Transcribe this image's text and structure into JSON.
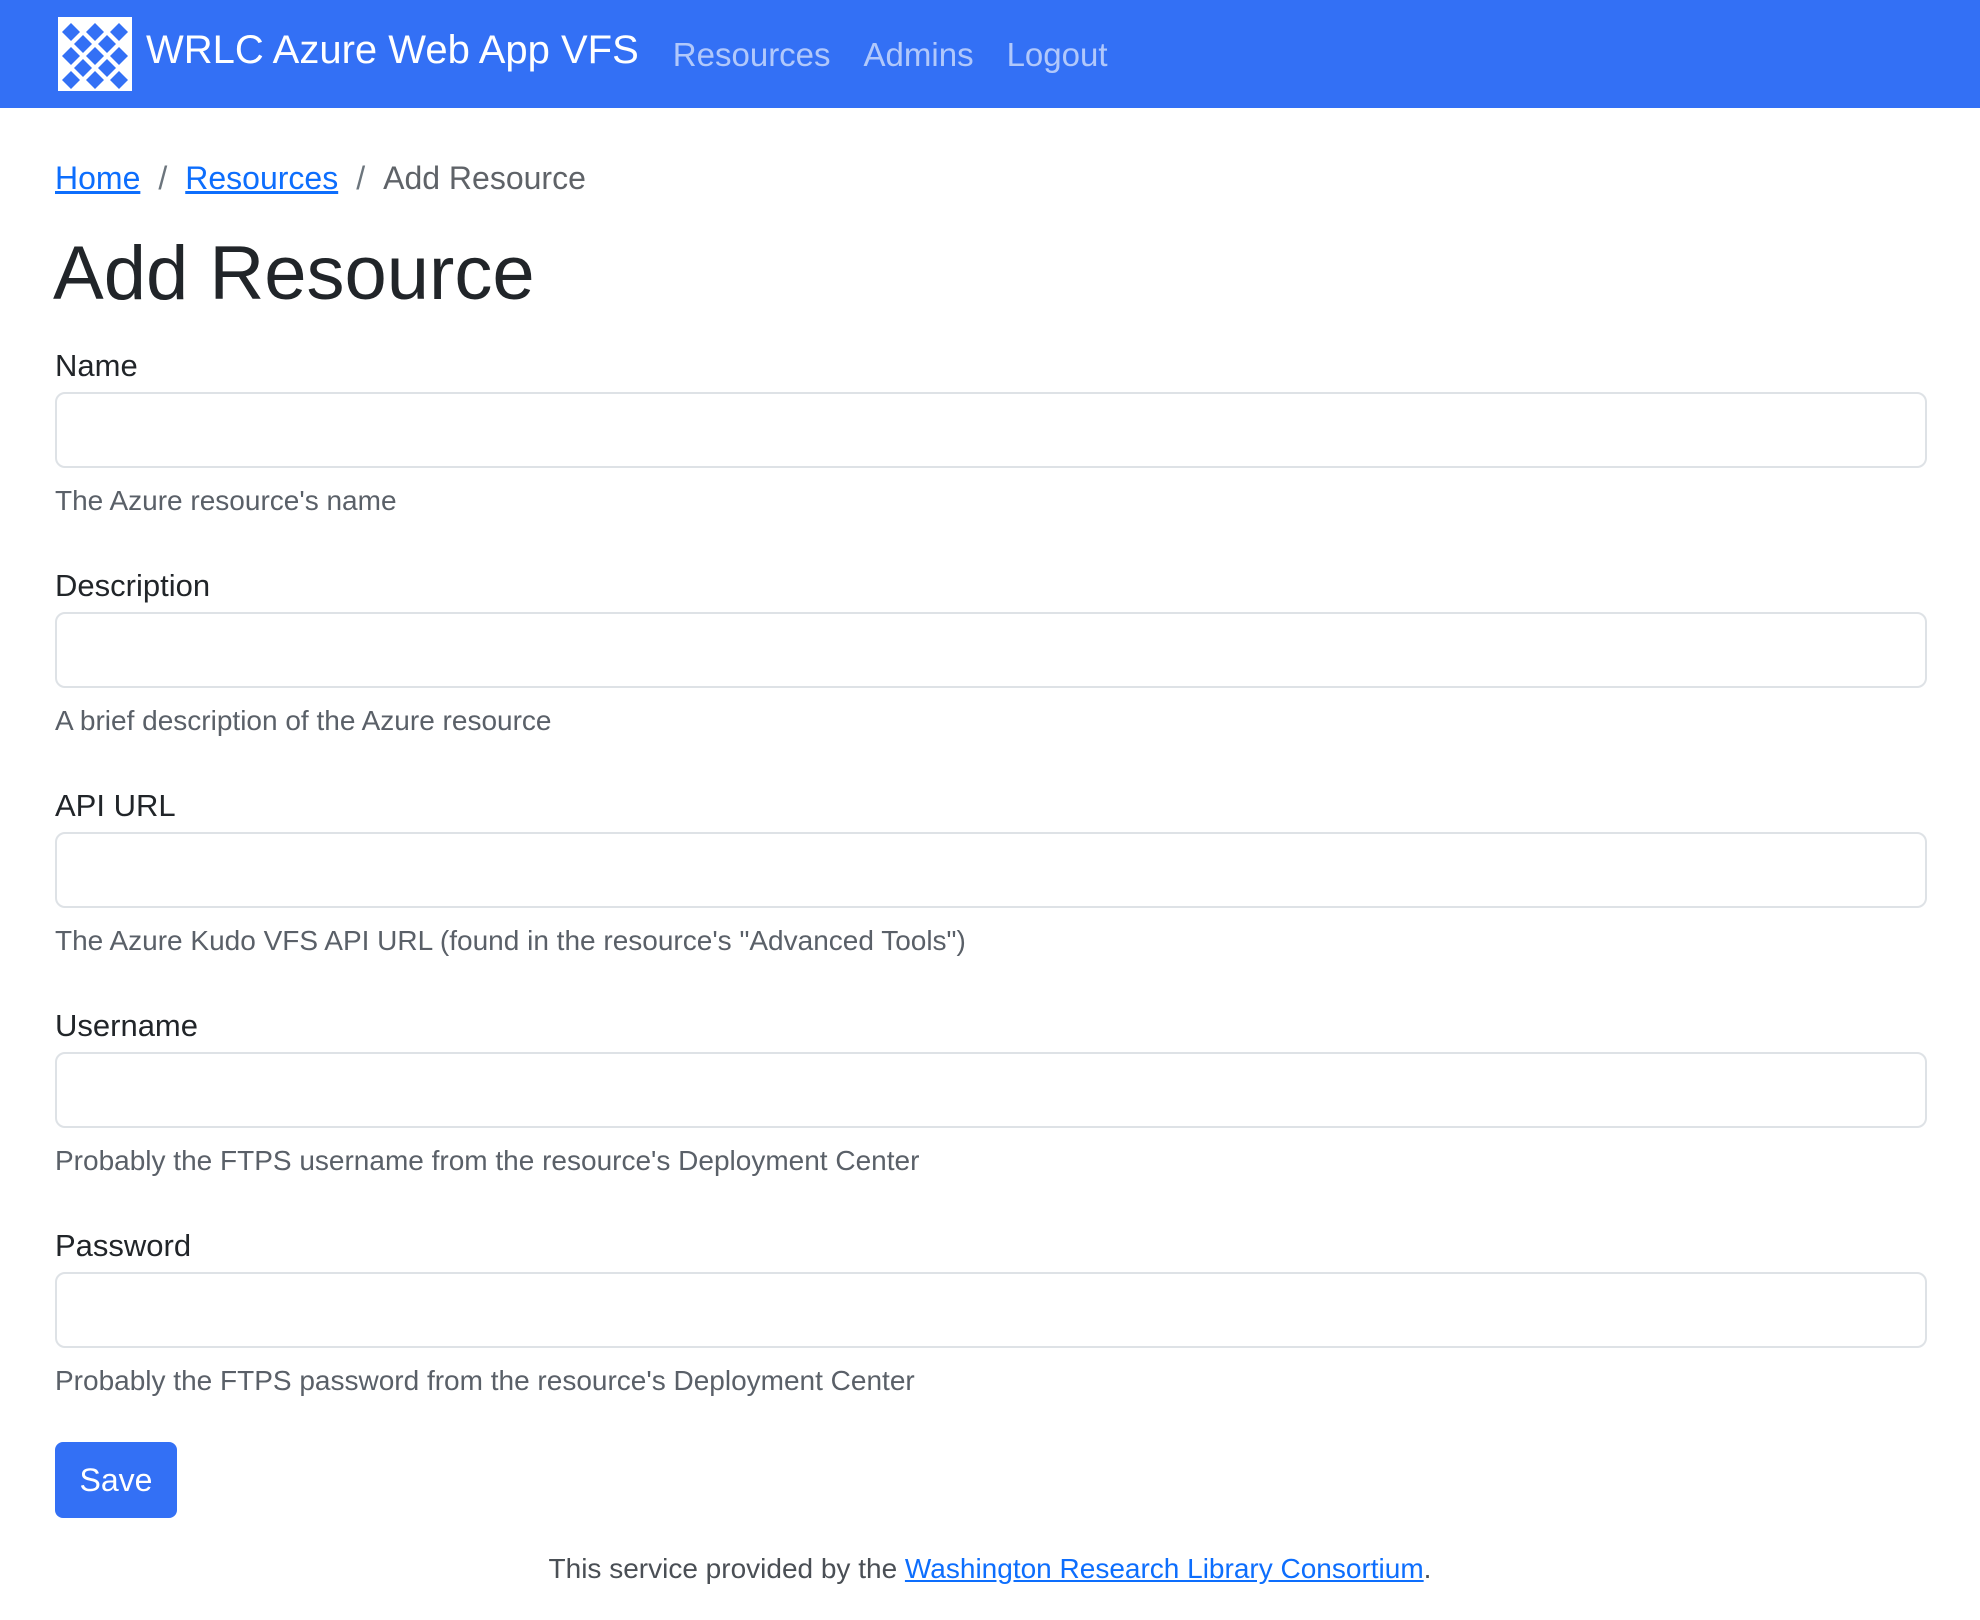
{
  "navbar": {
    "brand_title": "WRLC Azure Web App VFS",
    "logo_icon": "wrlc-logo-icon",
    "links": [
      {
        "label": "Resources"
      },
      {
        "label": "Admins"
      },
      {
        "label": "Logout"
      }
    ],
    "background_color": "#3370f5"
  },
  "breadcrumb": {
    "items": [
      {
        "label": "Home"
      },
      {
        "label": "Resources"
      }
    ],
    "separator": "/",
    "current": "Add Resource"
  },
  "page": {
    "title": "Add Resource"
  },
  "form": {
    "fields": [
      {
        "label": "Name",
        "value": "",
        "help": "The Azure resource's name"
      },
      {
        "label": "Description",
        "value": "",
        "help": "A brief description of the Azure resource"
      },
      {
        "label": "API URL",
        "value": "",
        "help": "The Azure Kudo VFS API URL (found in the resource's \"Advanced Tools\")"
      },
      {
        "label": "Username",
        "value": "",
        "help": "Probably the FTPS username from the resource's Deployment Center"
      },
      {
        "label": "Password",
        "value": "",
        "help": "Probably the FTPS password from the resource's Deployment Center"
      }
    ],
    "save_label": "Save"
  },
  "footer": {
    "prefix": "This service provided by the ",
    "link_label": "Washington Research Library Consortium",
    "suffix": "."
  },
  "colors": {
    "accent": "#3370f5",
    "link": "#0d6efd"
  }
}
